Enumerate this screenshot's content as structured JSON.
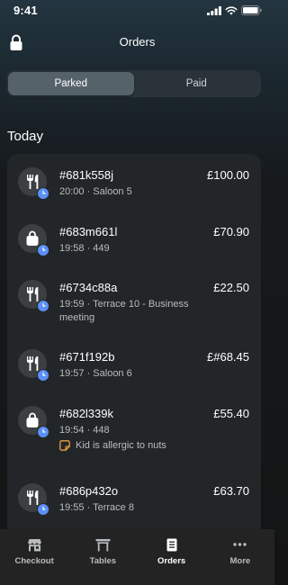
{
  "status_bar": {
    "time": "9:41"
  },
  "header": {
    "title": "Orders"
  },
  "segments": [
    {
      "label": "Parked",
      "active": true
    },
    {
      "label": "Paid",
      "active": false
    }
  ],
  "section": {
    "title": "Today"
  },
  "orders": [
    {
      "icon": "fork-knife-icon",
      "id": "#681k558j",
      "meta": "20:00 · Saloon 5",
      "amount": "£100.00",
      "note": ""
    },
    {
      "icon": "shopping-bag-icon",
      "id": "#683m661l",
      "meta": "19:58 · 449",
      "amount": "£70.90",
      "note": ""
    },
    {
      "icon": "fork-knife-icon",
      "id": "#6734c88a",
      "meta": "19:59 · Terrace 10 - Business meeting",
      "amount": "£22.50",
      "note": ""
    },
    {
      "icon": "fork-knife-icon",
      "id": "#671f192b",
      "meta": "19:57 · Saloon 6",
      "amount": "£#68.45",
      "note": ""
    },
    {
      "icon": "shopping-bag-icon",
      "id": "#682l339k",
      "meta": "19:54 · 448",
      "amount": "£55.40",
      "note": "Kid is allergic to nuts"
    },
    {
      "icon": "fork-knife-icon",
      "id": "#686p432o",
      "meta": "19:55 · Terrace 8",
      "amount": "£63.70",
      "note": ""
    }
  ],
  "tab_bar": [
    {
      "label": "Checkout",
      "icon": "storefront-icon",
      "active": false
    },
    {
      "label": "Tables",
      "icon": "table-icon",
      "active": false
    },
    {
      "label": "Orders",
      "icon": "receipt-icon",
      "active": true
    },
    {
      "label": "More",
      "icon": "more-dots-icon",
      "active": false
    }
  ],
  "colors": {
    "accent_blue": "#5b8ff5",
    "note_orange": "#e8a13a",
    "card": "#232628",
    "tab_bar": "#232323"
  }
}
